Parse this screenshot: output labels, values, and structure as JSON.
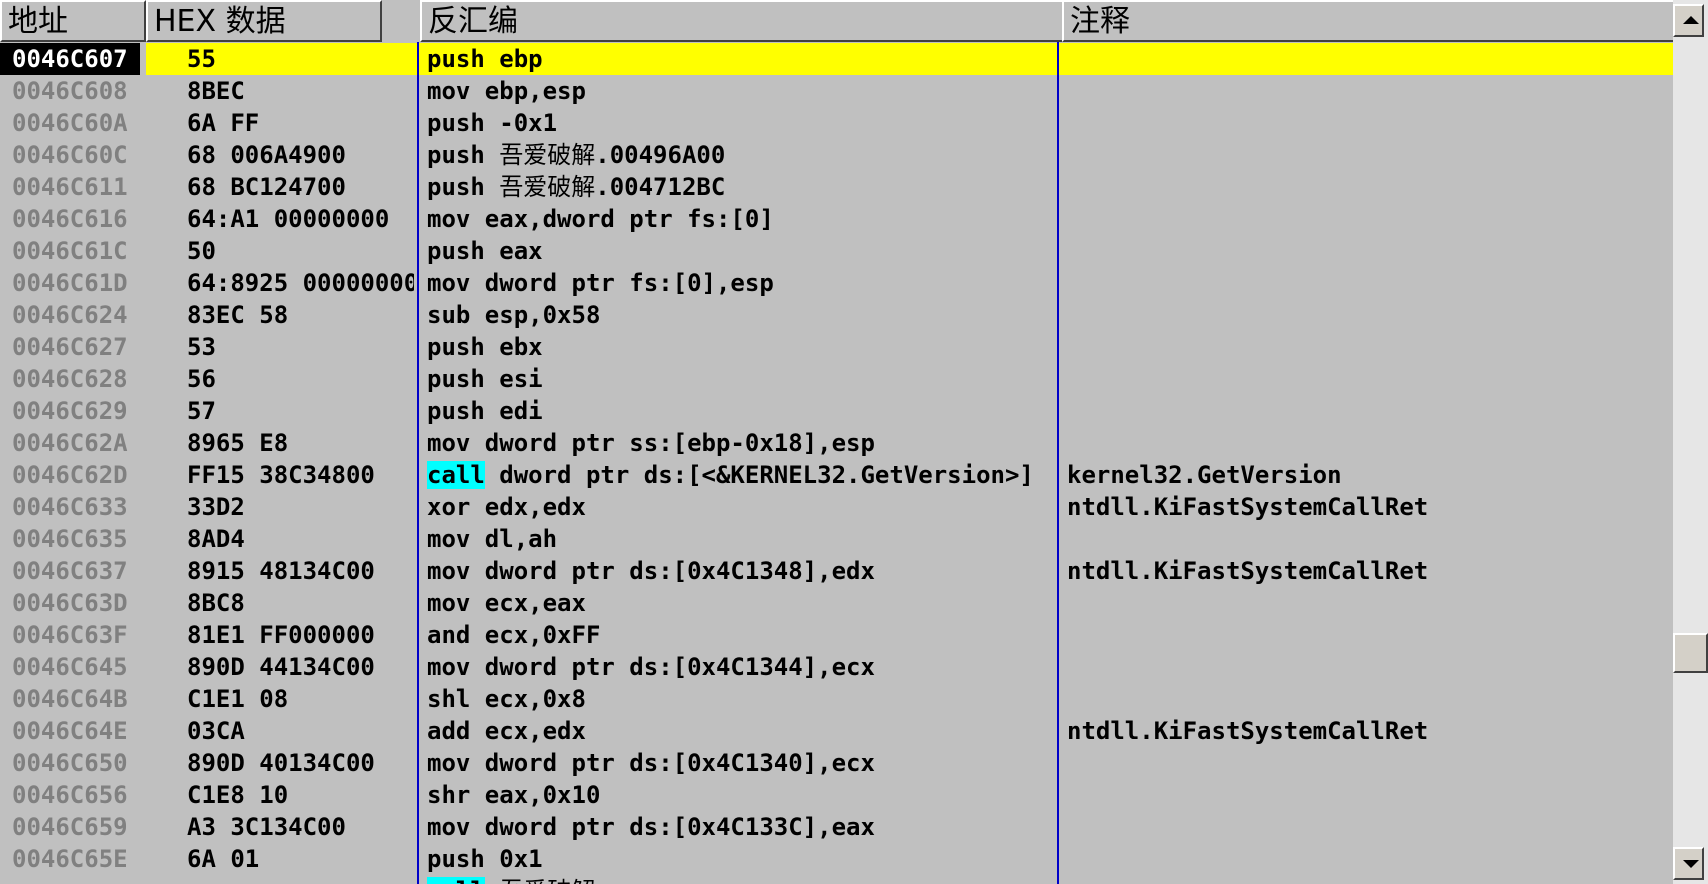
{
  "columns": {
    "address": "地址",
    "hex": "HEX 数据",
    "disasm": "反汇编",
    "comment": "注释"
  },
  "colors": {
    "background": "#c0c0c0",
    "selected_row": "#ffff00",
    "selected_address_bg": "#000000",
    "call_highlight": "#00ffff",
    "column_separator": "#0000c8",
    "address_text": "#808080"
  },
  "rows": [
    {
      "addr": "0046C607",
      "hex": "55",
      "asm": [
        "push ebp"
      ],
      "comment": "",
      "selected": true
    },
    {
      "addr": "0046C608",
      "hex": "8BEC",
      "asm": [
        "mov ebp,esp"
      ],
      "comment": ""
    },
    {
      "addr": "0046C60A",
      "hex": "6A FF",
      "asm": [
        "push -0x1"
      ],
      "comment": ""
    },
    {
      "addr": "0046C60C",
      "hex": "68 006A4900",
      "asm": [
        "push ",
        "吾爱破解",
        ".00496A00"
      ],
      "comment": ""
    },
    {
      "addr": "0046C611",
      "hex": "68 BC124700",
      "asm": [
        "push ",
        "吾爱破解",
        ".004712BC"
      ],
      "comment": ""
    },
    {
      "addr": "0046C616",
      "hex": "64:A1 00000000",
      "asm": [
        "mov eax,dword ptr fs:[0]"
      ],
      "comment": ""
    },
    {
      "addr": "0046C61C",
      "hex": "50",
      "asm": [
        "push eax"
      ],
      "comment": ""
    },
    {
      "addr": "0046C61D",
      "hex": "64:8925 00000000",
      "asm": [
        "mov dword ptr fs:[0],esp"
      ],
      "comment": ""
    },
    {
      "addr": "0046C624",
      "hex": "83EC 58",
      "asm": [
        "sub esp,0x58"
      ],
      "comment": ""
    },
    {
      "addr": "0046C627",
      "hex": "53",
      "asm": [
        "push ebx"
      ],
      "comment": ""
    },
    {
      "addr": "0046C628",
      "hex": "56",
      "asm": [
        "push esi"
      ],
      "comment": ""
    },
    {
      "addr": "0046C629",
      "hex": "57",
      "asm": [
        "push edi"
      ],
      "comment": ""
    },
    {
      "addr": "0046C62A",
      "hex": "8965 E8",
      "asm": [
        "mov dword ptr ss:[ebp-0x18],esp"
      ],
      "comment": ""
    },
    {
      "addr": "0046C62D",
      "hex": "FF15 38C34800",
      "asm": [
        "call",
        " dword ptr ds:[<&KERNEL32.GetVersion>]"
      ],
      "comment": "kernel32.GetVersion",
      "call": true
    },
    {
      "addr": "0046C633",
      "hex": "33D2",
      "asm": [
        "xor edx,edx"
      ],
      "comment": "ntdll.KiFastSystemCallRet"
    },
    {
      "addr": "0046C635",
      "hex": "8AD4",
      "asm": [
        "mov dl,ah"
      ],
      "comment": ""
    },
    {
      "addr": "0046C637",
      "hex": "8915 48134C00",
      "asm": [
        "mov dword ptr ds:[0x4C1348],edx"
      ],
      "comment": "ntdll.KiFastSystemCallRet"
    },
    {
      "addr": "0046C63D",
      "hex": "8BC8",
      "asm": [
        "mov ecx,eax"
      ],
      "comment": ""
    },
    {
      "addr": "0046C63F",
      "hex": "81E1 FF000000",
      "asm": [
        "and ecx,0xFF"
      ],
      "comment": ""
    },
    {
      "addr": "0046C645",
      "hex": "890D 44134C00",
      "asm": [
        "mov dword ptr ds:[0x4C1344],ecx"
      ],
      "comment": ""
    },
    {
      "addr": "0046C64B",
      "hex": "C1E1 08",
      "asm": [
        "shl ecx,0x8"
      ],
      "comment": ""
    },
    {
      "addr": "0046C64E",
      "hex": "03CA",
      "asm": [
        "add ecx,edx"
      ],
      "comment": "ntdll.KiFastSystemCallRet"
    },
    {
      "addr": "0046C650",
      "hex": "890D 40134C00",
      "asm": [
        "mov dword ptr ds:[0x4C1340],ecx"
      ],
      "comment": ""
    },
    {
      "addr": "0046C656",
      "hex": "C1E8 10",
      "asm": [
        "shr eax,0x10"
      ],
      "comment": ""
    },
    {
      "addr": "0046C659",
      "hex": "A3 3C134C00",
      "asm": [
        "mov dword ptr ds:[0x4C133C],eax"
      ],
      "comment": ""
    },
    {
      "addr": "0046C65E",
      "hex": "6A 01",
      "asm": [
        "push 0x1"
      ],
      "comment": ""
    },
    {
      "addr": "",
      "hex": "",
      "asm": [
        "call",
        " ",
        "吾爱破解",
        ""
      ],
      "comment": "",
      "call": true
    }
  ]
}
